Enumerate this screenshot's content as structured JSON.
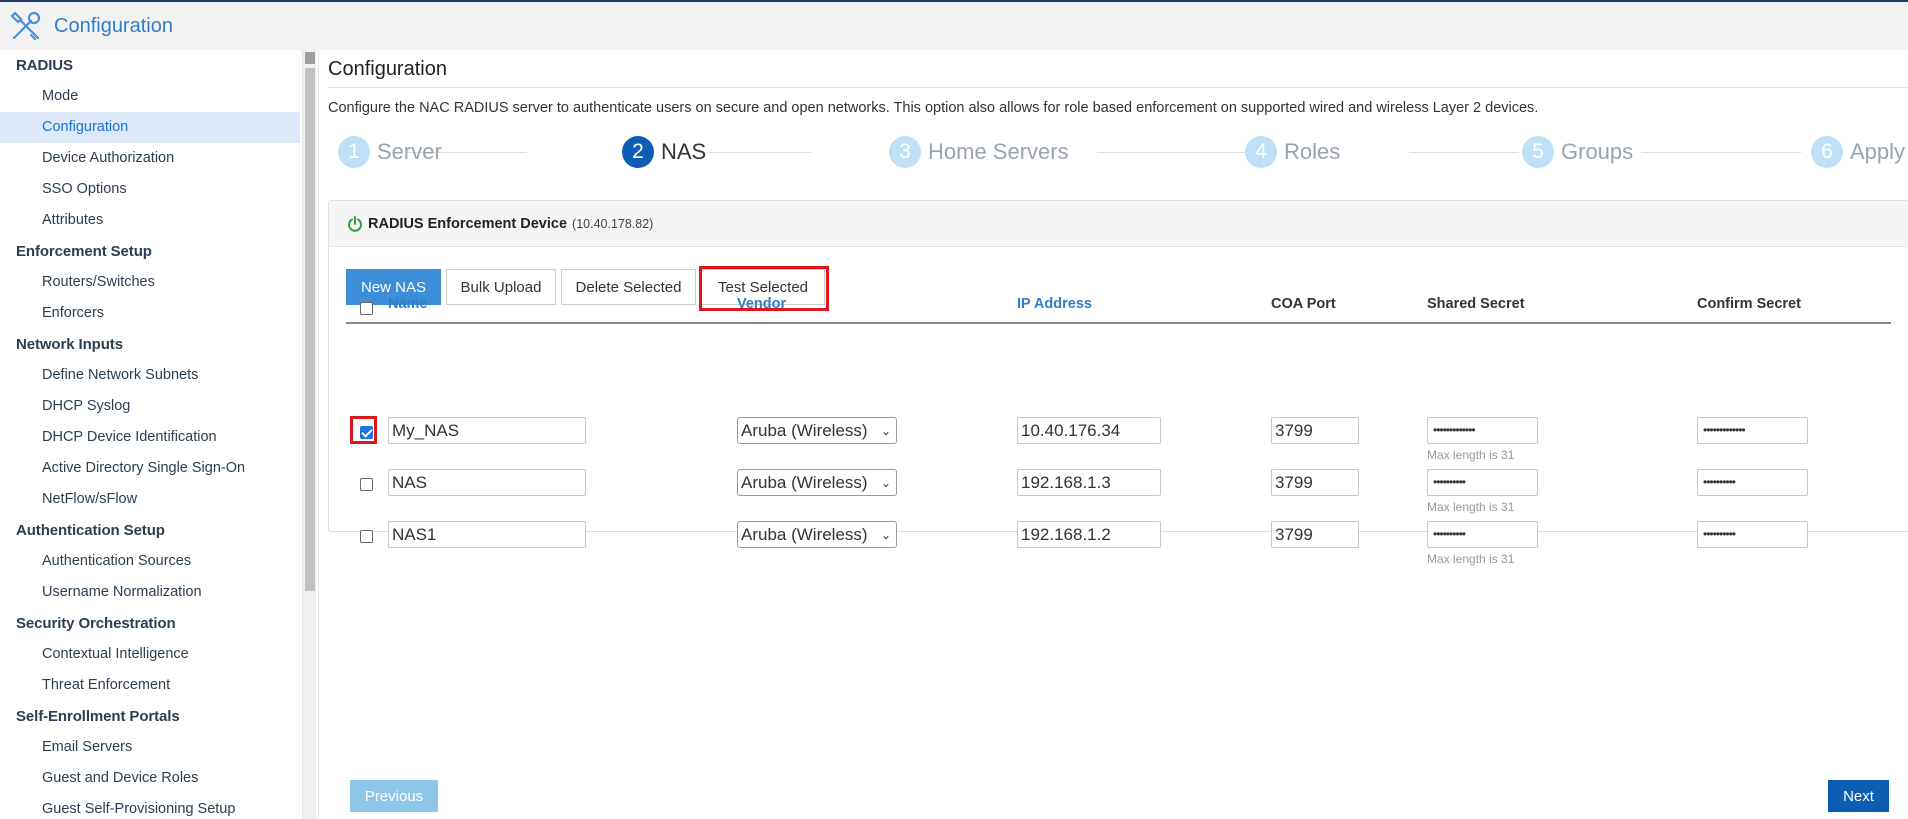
{
  "header": {
    "title": "Configuration",
    "logo_icon": "tools-icon"
  },
  "sidebar": {
    "sections": [
      {
        "group": "RADIUS",
        "items": [
          "Mode",
          "Configuration",
          "Device Authorization",
          "SSO Options",
          "Attributes"
        ]
      },
      {
        "group": "Enforcement Setup",
        "items": [
          "Routers/Switches",
          "Enforcers"
        ]
      },
      {
        "group": "Network Inputs",
        "items": [
          "Define Network Subnets",
          "DHCP Syslog",
          "DHCP Device Identification",
          "Active Directory Single Sign-On",
          "NetFlow/sFlow"
        ]
      },
      {
        "group": "Authentication Setup",
        "items": [
          "Authentication Sources",
          "Username Normalization"
        ]
      },
      {
        "group": "Security Orchestration",
        "items": [
          "Contextual Intelligence",
          "Threat Enforcement"
        ]
      },
      {
        "group": "Self-Enrollment Portals",
        "items": [
          "Email Servers",
          "Guest and Device Roles",
          "Guest Self-Provisioning Setup"
        ]
      }
    ],
    "active_item": "Configuration"
  },
  "main": {
    "title": "Configuration",
    "description": "Configure the NAC RADIUS server to authenticate users on secure and open networks. This option also allows for role based enforcement on supported wired and wireless Layer 2 devices.",
    "wizard": {
      "steps": [
        {
          "num": "1",
          "label": "Server"
        },
        {
          "num": "2",
          "label": "NAS"
        },
        {
          "num": "3",
          "label": "Home Servers"
        },
        {
          "num": "4",
          "label": "Roles"
        },
        {
          "num": "5",
          "label": "Groups"
        },
        {
          "num": "6",
          "label": "Apply"
        }
      ],
      "active_step": "2"
    },
    "panel": {
      "title": "RADIUS Enforcement Device",
      "ip": "(10.40.178.82)",
      "buttons": {
        "new_nas": "New NAS",
        "bulk_upload": "Bulk Upload",
        "delete_selected": "Delete Selected",
        "test_selected": "Test Selected"
      },
      "columns": {
        "name": "Name",
        "vendor": "Vendor",
        "ip": "IP Address",
        "coa_port": "COA Port",
        "shared_secret": "Shared Secret",
        "confirm_secret": "Confirm Secret"
      },
      "secret_hint": "Max length is 31",
      "rows": [
        {
          "checked": true,
          "name": "My_NAS",
          "vendor": "Aruba (Wireless)",
          "ip": "10.40.176.34",
          "coa_port": "3799",
          "shared_secret": "•••••••••••••",
          "confirm_secret": "•••••••••••••"
        },
        {
          "checked": false,
          "name": "NAS",
          "vendor": "Aruba (Wireless)",
          "ip": "192.168.1.3",
          "coa_port": "3799",
          "shared_secret": "••••••••••",
          "confirm_secret": "••••••••••"
        },
        {
          "checked": false,
          "name": "NAS1",
          "vendor": "Aruba (Wireless)",
          "ip": "192.168.1.2",
          "coa_port": "3799",
          "shared_secret": "••••••••••",
          "confirm_secret": "••••••••••"
        }
      ]
    },
    "footer": {
      "previous": "Previous",
      "next": "Next"
    }
  },
  "colors": {
    "accent": "#0d5eb3",
    "link": "#2f7fc8",
    "highlight": "#e0161e",
    "primary_button": "#3d8ed8"
  }
}
